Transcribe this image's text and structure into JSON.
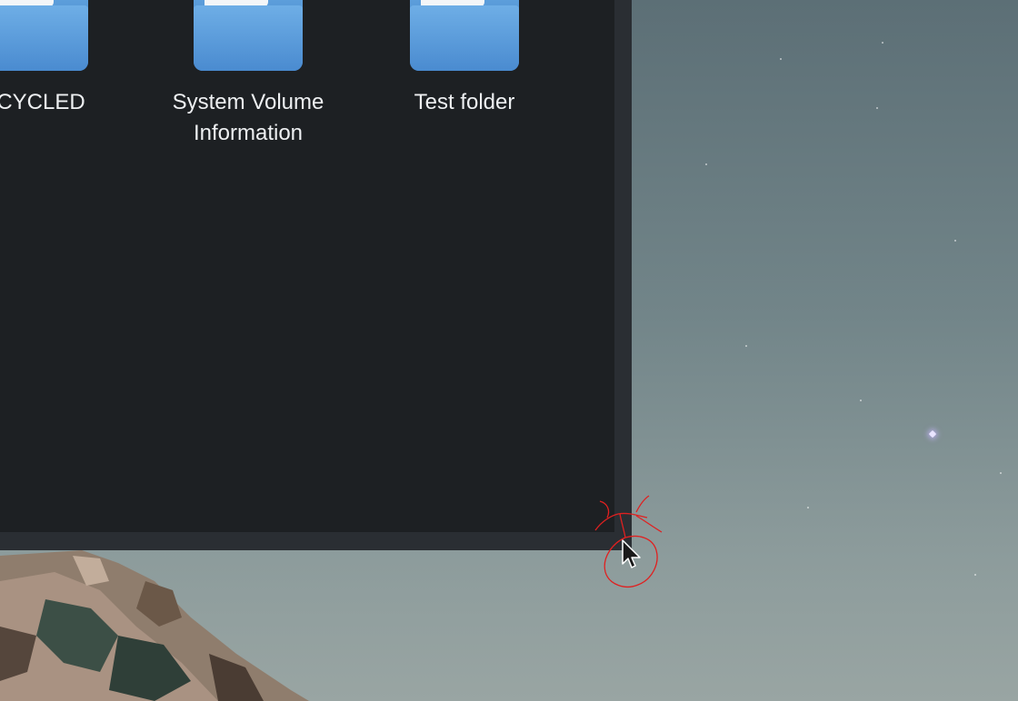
{
  "file_manager": {
    "items": [
      {
        "label": "ECYCLED",
        "icon": "folder-icon"
      },
      {
        "label": "System Volume\nInformation",
        "icon": "folder-icon"
      },
      {
        "label": "Test folder",
        "icon": "folder-icon"
      }
    ]
  },
  "colors": {
    "window_background": "#1d2023",
    "window_frame": "#2a2e33",
    "folder_blue": "#4a8bd0",
    "annotation_red": "#e02020"
  }
}
